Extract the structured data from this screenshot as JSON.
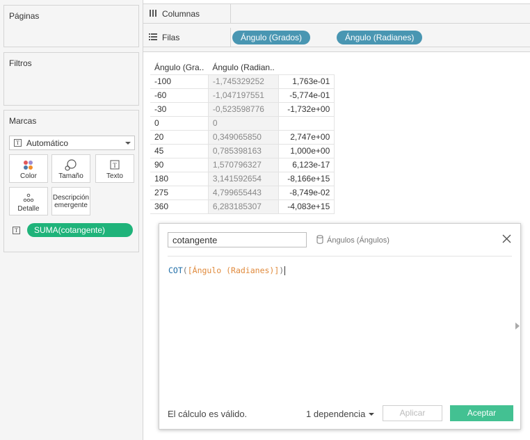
{
  "left_panel": {
    "pages_title": "Páginas",
    "filters_title": "Filtros",
    "marks_title": "Marcas",
    "mark_type": "Automático",
    "mark_buttons": {
      "color": "Color",
      "size": "Tamaño",
      "text": "Texto",
      "detail": "Detalle",
      "tooltip_line1": "Descripción",
      "tooltip_line2": "emergente"
    },
    "mark_pill": "SUMA(cotangente)"
  },
  "shelves": {
    "columns_label": "Columnas",
    "rows_label": "Filas",
    "row_pills": [
      "Ángulo (Grados)",
      "Ángulo (Radianes)"
    ]
  },
  "table": {
    "headers": [
      "Ángulo (Gra..",
      "Ángulo (Radian..",
      ""
    ],
    "rows": [
      [
        "-100",
        "-1,745329252",
        "1,763e-01"
      ],
      [
        "-60",
        "-1,047197551",
        "-5,774e-01"
      ],
      [
        "-30",
        "-0,523598776",
        "-1,732e+00"
      ],
      [
        "0",
        "0",
        ""
      ],
      [
        "20",
        "0,349065850",
        "2,747e+00"
      ],
      [
        "45",
        "0,785398163",
        "1,000e+00"
      ],
      [
        "90",
        "1,570796327",
        "6,123e-17"
      ],
      [
        "180",
        "3,141592654",
        "-8,166e+15"
      ],
      [
        "275",
        "4,799655443",
        "-8,749e-02"
      ],
      [
        "360",
        "6,283185307",
        "-4,083e+15"
      ]
    ]
  },
  "dialog": {
    "calc_name": "cotangente",
    "data_source": "Ángulos (Ángulos)",
    "formula_fn": "COT",
    "formula_open": "(",
    "formula_field": "[Ángulo (Radianes)]",
    "formula_close": ")",
    "status": "El cálculo es válido.",
    "dependencies": "1 dependencia",
    "apply_label": "Aplicar",
    "ok_label": "Aceptar"
  },
  "colors": {
    "blue_pill": "#4996b2",
    "green_pill": "#1fb37a",
    "ok_button": "#43c192",
    "formula_fn": "#1f6ea8",
    "formula_field": "#e08a3c"
  }
}
